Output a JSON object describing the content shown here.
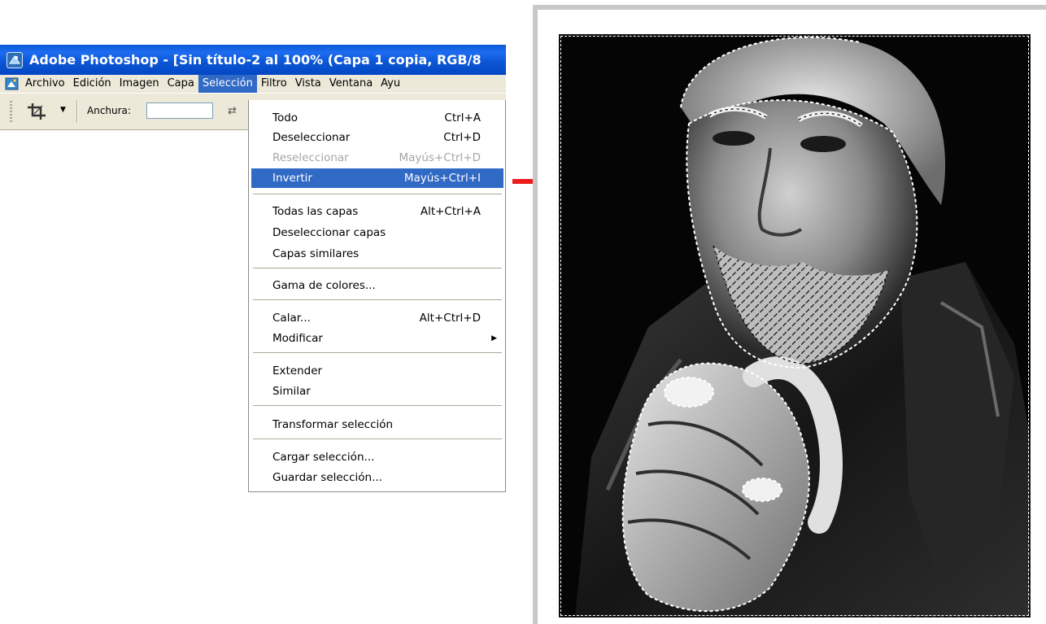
{
  "window": {
    "title": "Adobe Photoshop - [Sin título-2 al 100% (Capa 1 copia, RGB/8"
  },
  "menubar": {
    "items": [
      {
        "label": "Archivo",
        "active": false
      },
      {
        "label": "Edición",
        "active": false
      },
      {
        "label": "Imagen",
        "active": false
      },
      {
        "label": "Capa",
        "active": false
      },
      {
        "label": "Selección",
        "active": true
      },
      {
        "label": "Filtro",
        "active": false
      },
      {
        "label": "Vista",
        "active": false
      },
      {
        "label": "Ventana",
        "active": false
      },
      {
        "label": "Ayu",
        "active": false
      }
    ]
  },
  "options_bar": {
    "tool_icon": "crop-icon",
    "width_label": "Anchura:",
    "width_value": "",
    "swap_icon": "swap-icon"
  },
  "dropdown": {
    "items": [
      {
        "label": "Todo",
        "shortcut": "Ctrl+A",
        "state": "normal"
      },
      {
        "label": "Deseleccionar",
        "shortcut": "Ctrl+D",
        "state": "normal"
      },
      {
        "label": "Reseleccionar",
        "shortcut": "Mayús+Ctrl+D",
        "state": "disabled"
      },
      {
        "label": "Invertir",
        "shortcut": "Mayús+Ctrl+I",
        "state": "highlight"
      },
      {
        "label": "Todas las capas",
        "shortcut": "Alt+Ctrl+A",
        "state": "normal"
      },
      {
        "label": "Deseleccionar capas",
        "shortcut": "",
        "state": "normal"
      },
      {
        "label": "Capas similares",
        "shortcut": "",
        "state": "normal"
      },
      {
        "label": "Gama de colores...",
        "shortcut": "",
        "state": "normal"
      },
      {
        "label": "Calar...",
        "shortcut": "Alt+Ctrl+D",
        "state": "normal"
      },
      {
        "label": "Modificar",
        "shortcut": "",
        "state": "submenu"
      },
      {
        "label": "Extender",
        "shortcut": "",
        "state": "normal"
      },
      {
        "label": "Similar",
        "shortcut": "",
        "state": "normal"
      },
      {
        "label": "Transformar selección",
        "shortcut": "",
        "state": "normal"
      },
      {
        "label": "Cargar selección...",
        "shortcut": "",
        "state": "normal"
      },
      {
        "label": "Guardar selección...",
        "shortcut": "",
        "state": "normal"
      }
    ]
  },
  "colors": {
    "title_bar": "#0a58d8",
    "menu_highlight": "#316ac5",
    "arrow": "#ee1c1c",
    "photo_background": "#050505"
  }
}
